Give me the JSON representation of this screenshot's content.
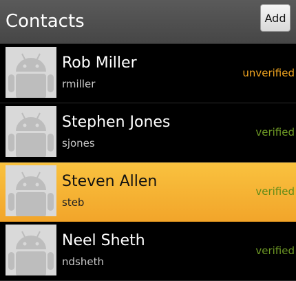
{
  "header": {
    "title": "Contacts",
    "add_label": "Add"
  },
  "colors": {
    "selected_bg": "#f7b733",
    "verified": "#6f9a25",
    "unverified": "#f0a420"
  },
  "contacts": [
    {
      "name": "Rob Miller",
      "username": "rmiller",
      "status": "unverified",
      "selected": false
    },
    {
      "name": "Stephen Jones",
      "username": "sjones",
      "status": "verified",
      "selected": false
    },
    {
      "name": "Steven Allen",
      "username": "steb",
      "status": "verified",
      "selected": true
    },
    {
      "name": "Neel Sheth",
      "username": "ndsheth",
      "status": "verified",
      "selected": false
    }
  ]
}
